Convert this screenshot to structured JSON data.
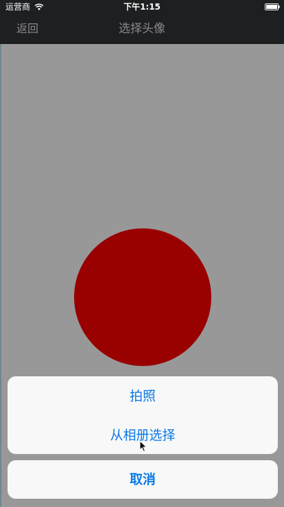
{
  "status_bar": {
    "carrier": "运营商",
    "time": "下午1:15",
    "wifi_icon": "wifi-icon",
    "battery_icon": "battery-icon"
  },
  "nav": {
    "back_label": "返回",
    "title": "选择头像"
  },
  "avatar": {
    "color": "#990000"
  },
  "action_sheet": {
    "options": [
      "拍照",
      "从相册选择"
    ],
    "cancel_label": "取消",
    "accent_color": "#0b7ae6"
  }
}
